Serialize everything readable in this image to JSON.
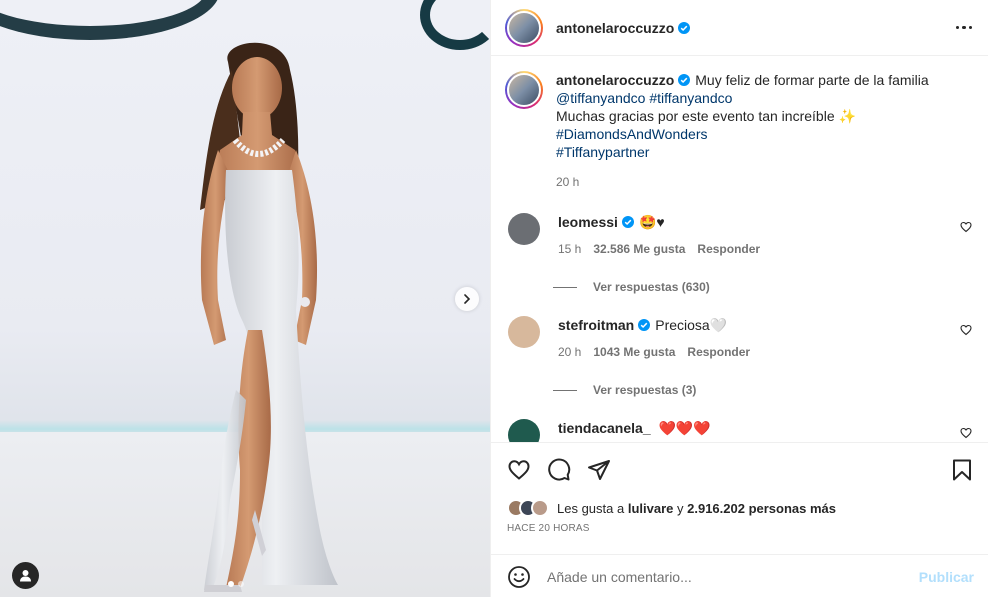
{
  "post": {
    "username": "antonelaroccuzzo",
    "more_icon": "more-horizontal-icon"
  },
  "caption": {
    "username": "antonelaroccuzzo",
    "line1": "Muy feliz de formar parte de la familia",
    "mention": "@tiffanyandco",
    "hashtag1": "#tiffanyandco",
    "line2": "Muchas gracias por este evento tan increíble",
    "emoji": "✨",
    "hashtag2": "#DiamondsAndWonders",
    "hashtag3": "#Tiffanypartner",
    "time": "20 h"
  },
  "comments": [
    {
      "username": "leomessi",
      "text": "🤩♥",
      "time": "15 h",
      "likes": "32.586 Me gusta",
      "reply": "Responder",
      "replies": "Ver respuestas (630)",
      "avatar_color": "#6b6e73"
    },
    {
      "username": "stefroitman",
      "text": "Preciosa🤍",
      "time": "20 h",
      "likes": "1043 Me gusta",
      "reply": "Responder",
      "replies": "Ver respuestas (3)",
      "avatar_color": "#d7b89c"
    },
    {
      "username": "tiendacanela_",
      "text": "❤️❤️❤️",
      "avatar_color": "#1f5a4e"
    }
  ],
  "likes": {
    "prefix": "Les gusta a",
    "user": "lulivare",
    "connector": "y",
    "count": "2.916.202 personas más"
  },
  "time_ago": "HACE 20 HORAS",
  "add_comment": {
    "placeholder": "Añade un comentario...",
    "publish": "Publicar"
  },
  "colors": {
    "verified": "#0095f6",
    "link": "#00376b",
    "publish_disabled": "#b2dffc"
  }
}
